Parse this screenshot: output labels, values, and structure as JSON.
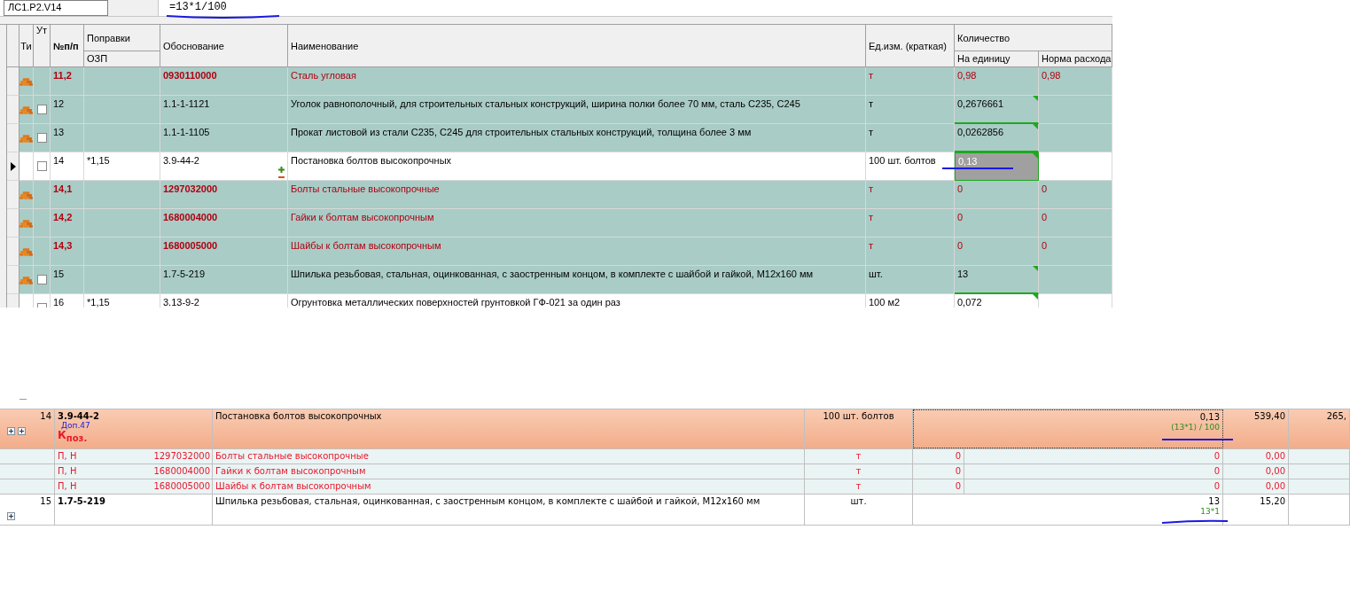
{
  "formula_bar": {
    "cell_ref": "ЛС1.Р2.V14",
    "formula": "=13*1/100"
  },
  "grid": {
    "headers": {
      "type": "Ти",
      "excluded": "Ут",
      "number": "№п/п",
      "corrections": "Поправки",
      "corrections_sub": "ОЗП",
      "basis": "Обоснование",
      "name": "Наименование",
      "unit": "Ед.изм. (краткая)",
      "quantity": "Количество",
      "per_unit": "На единицу",
      "norm": "Норма расхода"
    },
    "rows": [
      {
        "kind": "resource",
        "shaded": true,
        "current": false,
        "number": "11,2",
        "code": "0930110000",
        "name": "Сталь угловая",
        "unit": "т",
        "per_unit": "0,98",
        "norm": "0,98"
      },
      {
        "kind": "work",
        "shaded": true,
        "current": false,
        "checked": false,
        "number": "12",
        "code": "1.1-1-1121",
        "name": "Уголок равнополочный, для строительных стальных конструкций, ширина полки более 70 мм, сталь С235, С245",
        "unit": "т",
        "per_unit": "0,2676661"
      },
      {
        "kind": "work",
        "shaded": true,
        "current": false,
        "checked": false,
        "number": "13",
        "code": "1.1-1-1105",
        "name": "Прокат листовой из стали С235, С245 для строительных стальных конструкций, толщина более 3 мм",
        "unit": "т",
        "per_unit": "0,0262856"
      },
      {
        "kind": "work",
        "shaded": false,
        "current": true,
        "checked": false,
        "number": "14",
        "correction": "*1,15",
        "code": "3.9-44-2",
        "name": "Постановка болтов высокопрочных",
        "unit": "100 шт. болтов",
        "per_unit": "0,13"
      },
      {
        "kind": "resource",
        "shaded": true,
        "current": false,
        "number": "14,1",
        "code": "1297032000",
        "name": "Болты стальные высокопрочные",
        "unit": "т",
        "per_unit": "0",
        "norm": "0"
      },
      {
        "kind": "resource",
        "shaded": true,
        "current": false,
        "number": "14,2",
        "code": "1680004000",
        "name": "Гайки к болтам высокопрочным",
        "unit": "т",
        "per_unit": "0",
        "norm": "0"
      },
      {
        "kind": "resource",
        "shaded": true,
        "current": false,
        "number": "14,3",
        "code": "1680005000",
        "name": "Шайбы к болтам высокопрочным",
        "unit": "т",
        "per_unit": "0",
        "norm": "0"
      },
      {
        "kind": "work",
        "shaded": true,
        "current": false,
        "checked": false,
        "number": "15",
        "code": "1.7-5-219",
        "name": "Шпилька резьбовая, стальная, оцинкованная, с заостренным концом, в комплекте с шайбой и гайкой, М12х160 мм",
        "unit": "шт.",
        "per_unit": "13"
      },
      {
        "kind": "work",
        "shaded": false,
        "current": false,
        "checked": false,
        "number": "16",
        "correction": "*1,15",
        "code": "3.13-9-2",
        "name": "Огрунтовка металлических поверхностей грунтовкой ГФ-021 за один раз",
        "unit": "100 м2",
        "per_unit": "0,072"
      }
    ]
  },
  "report": {
    "rows": [
      {
        "kind": "position",
        "focused": true,
        "number": "14",
        "code": "3.9-44-2",
        "note": "Доп.47",
        "coefficient": "К$_{поз.}$",
        "name": "Постановка болтов высокопрочных",
        "unit": "100 шт. болтов",
        "quantity": "0,13",
        "formula": "(13*1) / 100",
        "price": "539,40",
        "column_8": "265,"
      },
      {
        "kind": "resource",
        "tag": "П, Н",
        "code": "1297032000",
        "name": "Болты стальные высокопрочные",
        "unit": "т",
        "base": "0",
        "quantity": "0",
        "price": "0,00"
      },
      {
        "kind": "resource",
        "tag": "П, Н",
        "code": "1680004000",
        "name": "Гайки к болтам высокопрочным",
        "unit": "т",
        "base": "0",
        "quantity": "0",
        "price": "0,00"
      },
      {
        "kind": "resource",
        "tag": "П, Н",
        "code": "1680005000",
        "name": "Шайбы к болтам высокопрочным",
        "unit": "т",
        "base": "0",
        "quantity": "0",
        "price": "0,00"
      },
      {
        "kind": "position",
        "focused": false,
        "number": "15",
        "code": "1.7-5-219",
        "name": "Шпилька резьбовая, стальная, оцинкованная, с заостренным концом, в комплекте с шайбой и гайкой, М12х160 мм",
        "unit": "шт.",
        "quantity": "13",
        "formula": "13*1",
        "price": "15,20"
      }
    ]
  }
}
